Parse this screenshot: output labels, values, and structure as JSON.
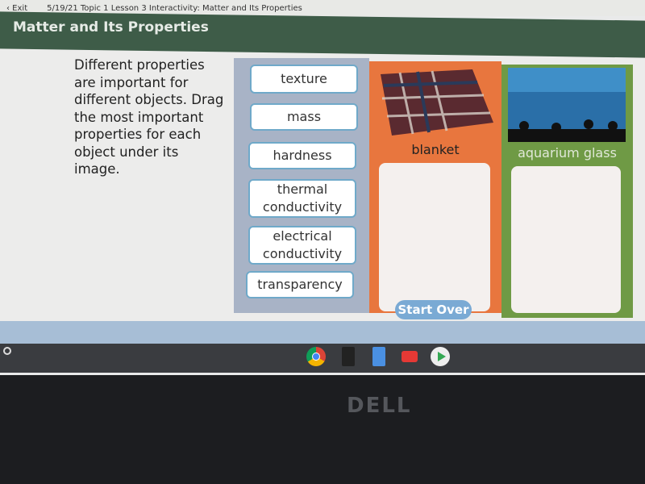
{
  "topbar": {
    "exit": "‹ Exit",
    "lesson": "5/19/21 Topic 1 Lesson 3 Interactivity: Matter and Its Properties"
  },
  "header": {
    "title": "Matter and Its Properties"
  },
  "instructions": "Different properties are important for different objects. Drag the most important properties for each object under its image.",
  "properties": [
    "texture",
    "mass",
    "hardness",
    "thermal conductivity",
    "electrical conductivity",
    "transparency"
  ],
  "objects": [
    {
      "label": "blanket",
      "color": "#e8763e"
    },
    {
      "label": "aquarium glass",
      "color": "#6f9a45"
    }
  ],
  "start_over": "Start Over",
  "shelf_apps": [
    "chrome-icon",
    "calculator-icon",
    "docs-icon",
    "youtube-icon",
    "play-store-icon"
  ],
  "brand": "DELL"
}
